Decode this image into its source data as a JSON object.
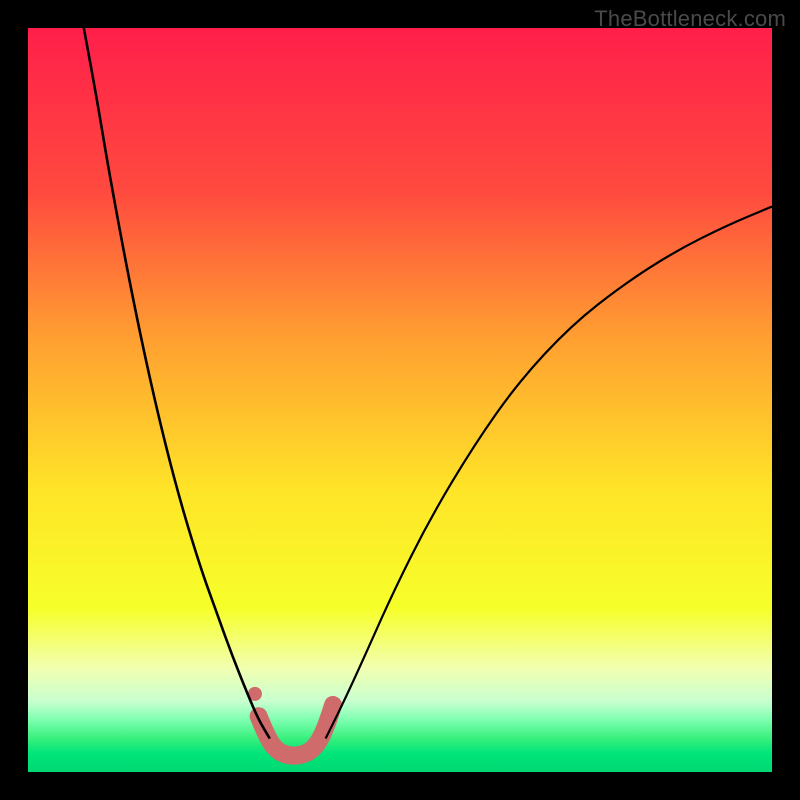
{
  "watermark": "TheBottleneck.com",
  "chart_data": {
    "type": "line",
    "title": "",
    "xlabel": "",
    "ylabel": "",
    "xlim": [
      0,
      100
    ],
    "ylim": [
      0,
      100
    ],
    "gradient_stops": [
      {
        "offset": 0.0,
        "color": "#ff1f4a"
      },
      {
        "offset": 0.22,
        "color": "#ff4a3f"
      },
      {
        "offset": 0.42,
        "color": "#ffa031"
      },
      {
        "offset": 0.62,
        "color": "#ffe428"
      },
      {
        "offset": 0.78,
        "color": "#f6ff2a"
      },
      {
        "offset": 0.86,
        "color": "#f2ffb0"
      },
      {
        "offset": 0.905,
        "color": "#c8ffd0"
      },
      {
        "offset": 0.93,
        "color": "#7dffb0"
      },
      {
        "offset": 0.955,
        "color": "#38ef7d"
      },
      {
        "offset": 0.975,
        "color": "#00e57a"
      },
      {
        "offset": 1.0,
        "color": "#00d873"
      }
    ],
    "series": [
      {
        "name": "left-descent",
        "x": [
          7.5,
          9,
          11,
          14,
          17,
          20,
          23,
          25.5,
          27.5,
          29.5,
          31,
          32.5
        ],
        "y": [
          100,
          92,
          80,
          64,
          50,
          38,
          28,
          21,
          15.5,
          10.5,
          7,
          4.5
        ]
      },
      {
        "name": "right-ascent",
        "x": [
          40,
          42,
          45,
          49,
          54,
          60,
          66,
          73,
          80,
          87,
          94,
          100
        ],
        "y": [
          4.5,
          8.5,
          15,
          24,
          34,
          44,
          52.5,
          60,
          65.5,
          70,
          73.5,
          76
        ]
      },
      {
        "name": "valley-highlight",
        "x": [
          31,
          32.2,
          33.5,
          35,
          36.5,
          38,
          39.2,
          40.2,
          41
        ],
        "y": [
          7.5,
          4.5,
          2.8,
          2.2,
          2.2,
          2.8,
          4.2,
          6.5,
          9
        ]
      },
      {
        "name": "upper-dot",
        "x": [
          30.5
        ],
        "y": [
          10.5
        ]
      }
    ],
    "styles": {
      "left-descent": {
        "stroke": "#000000",
        "stroke_width": 2.6,
        "fill": "none"
      },
      "right-ascent": {
        "stroke": "#000000",
        "stroke_width": 2.2,
        "fill": "none"
      },
      "valley-highlight": {
        "stroke": "#cf6b6b",
        "stroke_width": 18,
        "fill": "none",
        "linecap": "round"
      },
      "upper-dot": {
        "fill": "#cf6b6b",
        "radius": 7
      }
    }
  }
}
